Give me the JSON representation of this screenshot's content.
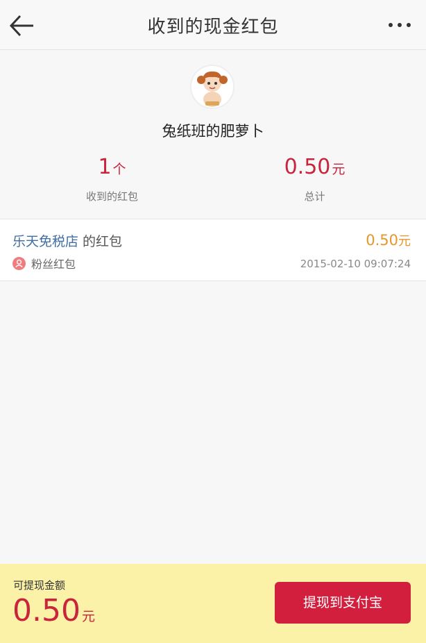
{
  "header": {
    "title": "收到的现金红包",
    "back_icon": "arrow-left-icon",
    "more_icon": "more-dots-icon"
  },
  "profile": {
    "avatar": "cartoon-girl-avatar",
    "name": "兔纸班的肥萝卜"
  },
  "stats": {
    "count_value": "1",
    "count_unit": "个",
    "count_label": "收到的红包",
    "total_value": "0.50",
    "total_unit": "元",
    "total_label": "总计"
  },
  "records": [
    {
      "shop": "乐天免税店",
      "suffix": "的红包",
      "type": "粉丝红包",
      "type_icon": "person-badge-icon",
      "amount": "0.50",
      "unit": "元",
      "time": "2015-02-10 09:07:24"
    }
  ],
  "footer": {
    "label": "可提现金额",
    "amount": "0.50",
    "unit": "元",
    "button": "提现到支付宝"
  },
  "colors": {
    "accent_red": "#c8243c",
    "amount_orange": "#e8952a",
    "link_blue": "#3f6ea2",
    "footer_yellow": "#fbf2a8",
    "button_red": "#d21f3e"
  }
}
